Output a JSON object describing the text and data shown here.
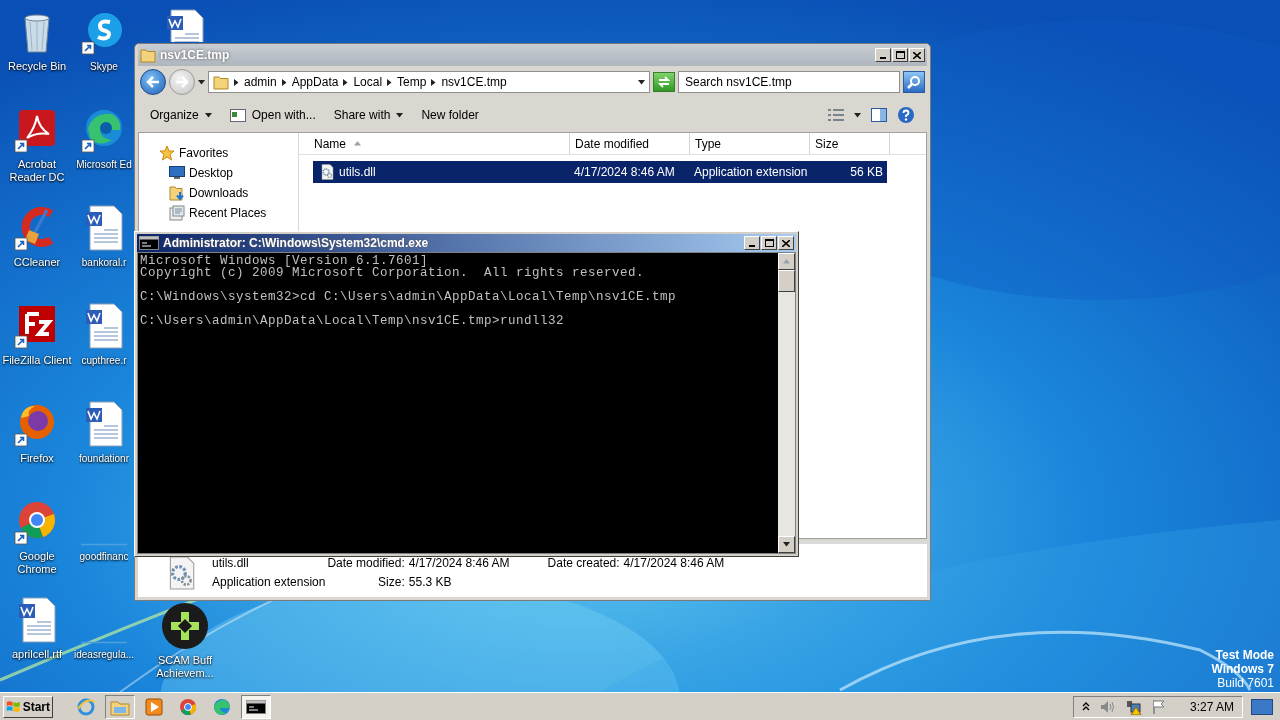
{
  "desktop": {
    "icon_columns": [
      [
        {
          "label": "Recycle Bin",
          "kind": "recycle-bin",
          "shortcut": false
        },
        {
          "label": "Acrobat\nReader DC",
          "kind": "acrobat",
          "shortcut": true
        },
        {
          "label": "CCleaner",
          "kind": "ccleaner",
          "shortcut": true
        },
        {
          "label": "FileZilla Client",
          "kind": "filezilla",
          "shortcut": true
        },
        {
          "label": "Firefox",
          "kind": "firefox",
          "shortcut": true
        },
        {
          "label": "Google\nChrome",
          "kind": "chrome",
          "shortcut": true
        },
        {
          "label": "aprilcell.rtf",
          "kind": "word",
          "shortcut": false
        }
      ],
      [
        {
          "label": "Skype",
          "kind": "skype",
          "shortcut": true
        },
        {
          "label": "Microsoft Ed",
          "kind": "edge",
          "shortcut": true
        },
        {
          "label": "bankoral.r",
          "kind": "word",
          "shortcut": false
        },
        {
          "label": "cupthree.r",
          "kind": "word",
          "shortcut": false
        },
        {
          "label": "foundationr",
          "kind": "word",
          "shortcut": false
        },
        {
          "label": "goodfinanc",
          "kind": "blank"
        },
        {
          "label": "ideasregula...",
          "kind": "blank"
        }
      ],
      [
        {
          "kind": "word",
          "shortcut": false
        },
        {
          "label": "SCAM Buff\nAchievem...",
          "kind": "gamepad",
          "shortcut": false
        }
      ]
    ],
    "build_info": [
      "Test Mode",
      "Windows 7",
      "Build 7601"
    ]
  },
  "explorer": {
    "title": "nsv1CE.tmp",
    "active": false,
    "breadcrumb": [
      "admin",
      "AppData",
      "Local",
      "Temp",
      "nsv1CE.tmp"
    ],
    "search": {
      "placeholder": "Search nsv1CE.tmp"
    },
    "toolbar": [
      {
        "label": "Organize",
        "kind": "menu"
      },
      {
        "label": "Open with...",
        "kind": "app"
      },
      {
        "label": "Share with",
        "kind": "menu"
      },
      {
        "label": "New folder",
        "kind": "plain"
      }
    ],
    "nav": [
      {
        "label": "Favorites",
        "kind": "star",
        "children": [
          {
            "label": "Desktop",
            "kind": "desktop"
          },
          {
            "label": "Downloads",
            "kind": "downloads"
          },
          {
            "label": "Recent Places",
            "kind": "recent"
          }
        ]
      }
    ],
    "columns": [
      {
        "label": "Name",
        "sorted": true
      },
      {
        "label": "Date modified",
        "sorted": false
      },
      {
        "label": "Type",
        "sorted": false
      },
      {
        "label": "Size",
        "sorted": false
      }
    ],
    "files": [
      {
        "name": "utils.dll",
        "date_modified": "4/17/2024 8:46 AM",
        "type": "Application extension",
        "size": "56 KB",
        "selected": true
      }
    ],
    "details": {
      "name": "utils.dll",
      "type": "Application extension",
      "field_columns": [
        [
          {
            "label": "Date modified:",
            "value": "4/17/2024 8:46 AM"
          },
          {
            "label": "Size:",
            "value": "55.3 KB"
          }
        ],
        [
          {
            "label": "Date created:",
            "value": "4/17/2024 8:46 AM"
          }
        ]
      ]
    }
  },
  "console": {
    "title": "Administrator: C:\\Windows\\System32\\cmd.exe",
    "active": true,
    "blocks": [
      [
        "Microsoft Windows [Version 6.1.7601]",
        "Copyright (c) 2009 Microsoft Corporation.  All rights reserved."
      ],
      [
        "C:\\Windows\\system32>cd C:\\Users\\admin\\AppData\\Local\\Temp\\nsv1CE.tmp"
      ],
      [
        "C:\\Users\\admin\\AppData\\Local\\Temp\\nsv1CE.tmp>rundll32"
      ]
    ]
  },
  "taskbar": {
    "start": "Start",
    "apps": [
      {
        "kind": "ie",
        "open": false,
        "selected": false
      },
      {
        "kind": "explorer",
        "open": true,
        "selected": false
      },
      {
        "kind": "media",
        "open": false,
        "selected": false
      },
      {
        "kind": "chrome",
        "open": false,
        "selected": false
      },
      {
        "kind": "edge",
        "open": false,
        "selected": false
      },
      {
        "kind": "cmd",
        "open": true,
        "selected": true
      }
    ],
    "time": "3:27 AM"
  }
}
